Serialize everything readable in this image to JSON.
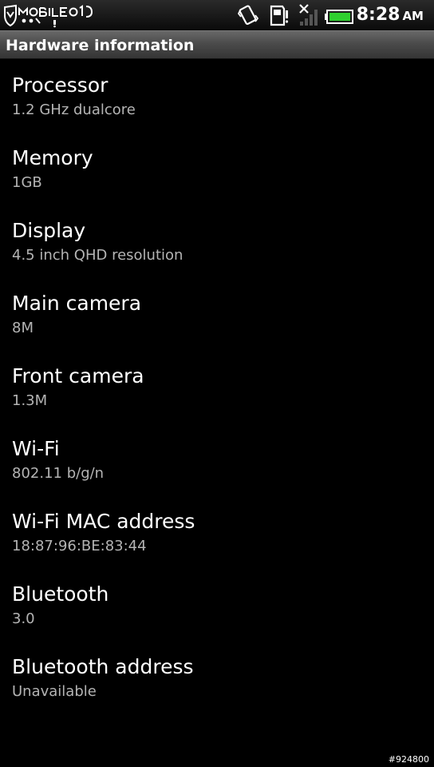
{
  "status_bar": {
    "time": "8:28",
    "ampm": "AM",
    "icons": [
      "mobile01-logo",
      "vibrate-icon",
      "sd-card-icon",
      "no-signal-icon",
      "battery-icon"
    ],
    "battery_color": "#2fd02f",
    "logo_text": "MOBILE01"
  },
  "header": {
    "title": "Hardware information"
  },
  "items": [
    {
      "label": "Processor",
      "value": "1.2 GHz dualcore"
    },
    {
      "label": "Memory",
      "value": "1GB"
    },
    {
      "label": "Display",
      "value": "4.5 inch QHD resolution"
    },
    {
      "label": "Main camera",
      "value": "8M"
    },
    {
      "label": "Front camera",
      "value": "1.3M"
    },
    {
      "label": "Wi-Fi",
      "value": "802.11 b/g/n"
    },
    {
      "label": "Wi-Fi MAC address",
      "value": "18:87:96:BE:83:44"
    },
    {
      "label": "Bluetooth",
      "value": "3.0"
    },
    {
      "label": "Bluetooth address",
      "value": "Unavailable"
    }
  ],
  "footer": {
    "tag": "#924800"
  }
}
